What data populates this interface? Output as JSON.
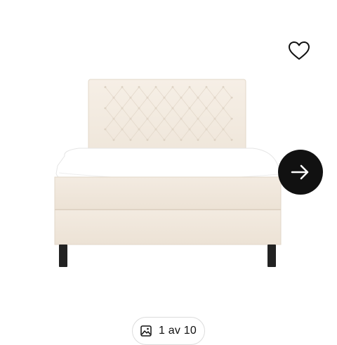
{
  "gallery": {
    "product_image_icon": "bed-illustration",
    "favorite_icon": "heart-outline-icon",
    "next_icon": "arrow-right-icon",
    "counter": {
      "icon": "gallery-image-icon",
      "text": "1 av 10"
    }
  },
  "colors": {
    "fabric": "#f1e8dc",
    "mattress": "#ffffff",
    "legs": "#222222",
    "next_button_bg": "#111111"
  }
}
